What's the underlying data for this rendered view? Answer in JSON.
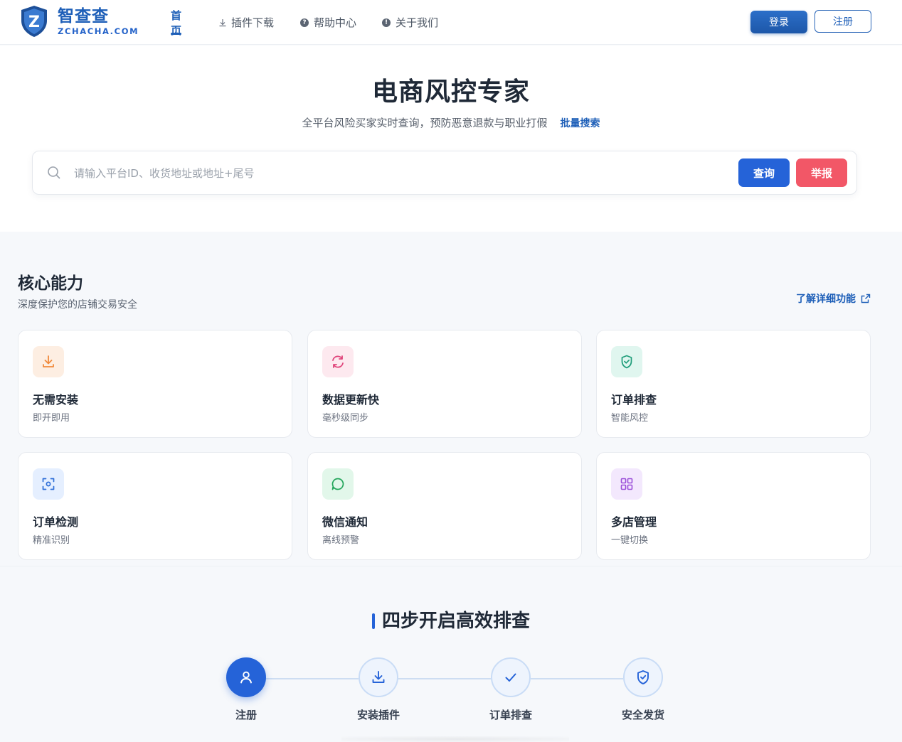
{
  "brand": {
    "name": "智查查",
    "domain": "ZCHACHA.COM",
    "logo_letter": "Z"
  },
  "nav": [
    {
      "label": "首页",
      "icon": ""
    },
    {
      "label": "插件下载",
      "icon": "download-icon"
    },
    {
      "label": "帮助中心",
      "icon": "help-icon"
    },
    {
      "label": "关于我们",
      "icon": "info-icon"
    }
  ],
  "auth": {
    "login": "登录",
    "register": "注册"
  },
  "hero": {
    "title": "电商风控专家",
    "subtitle": "全平台风险买家实时查询，预防恶意退款与职业打假",
    "batch_search": "批量搜索",
    "search_placeholder": "请输入平台ID、收货地址或地址+尾号",
    "query_button": "查询",
    "report_button": "举报"
  },
  "core": {
    "title": "核心能力",
    "subtitle": "深度保护您的店铺交易安全",
    "link": "了解详细功能",
    "cards": [
      {
        "title": "无需安装",
        "sub": "即开即用",
        "icon": "download-icon",
        "color": "#f08a3c",
        "bg": "#fdeee2"
      },
      {
        "title": "数据更新快",
        "sub": "毫秒级同步",
        "icon": "refresh-icon",
        "color": "#e0457b",
        "bg": "#fde9ef"
      },
      {
        "title": "订单排查",
        "sub": "智能风控",
        "icon": "shield-check-icon",
        "color": "#1f9d7a",
        "bg": "#e0f6ef"
      },
      {
        "title": "订单检测",
        "sub": "精准识别",
        "icon": "scan-icon",
        "color": "#2f6fd8",
        "bg": "#e5efff"
      },
      {
        "title": "微信通知",
        "sub": "离线预警",
        "icon": "chat-icon",
        "color": "#22a55a",
        "bg": "#e2f7ea"
      },
      {
        "title": "多店管理",
        "sub": "一键切换",
        "icon": "grid-icon",
        "color": "#9b4fd9",
        "bg": "#f3e8fd"
      }
    ]
  },
  "steps": {
    "title": "四步开启高效排查",
    "items": [
      {
        "label": "注册",
        "icon": "user-icon"
      },
      {
        "label": "安装插件",
        "icon": "download-icon"
      },
      {
        "label": "订单排查",
        "icon": "check-icon"
      },
      {
        "label": "安全发货",
        "icon": "shield-check-icon"
      }
    ]
  }
}
